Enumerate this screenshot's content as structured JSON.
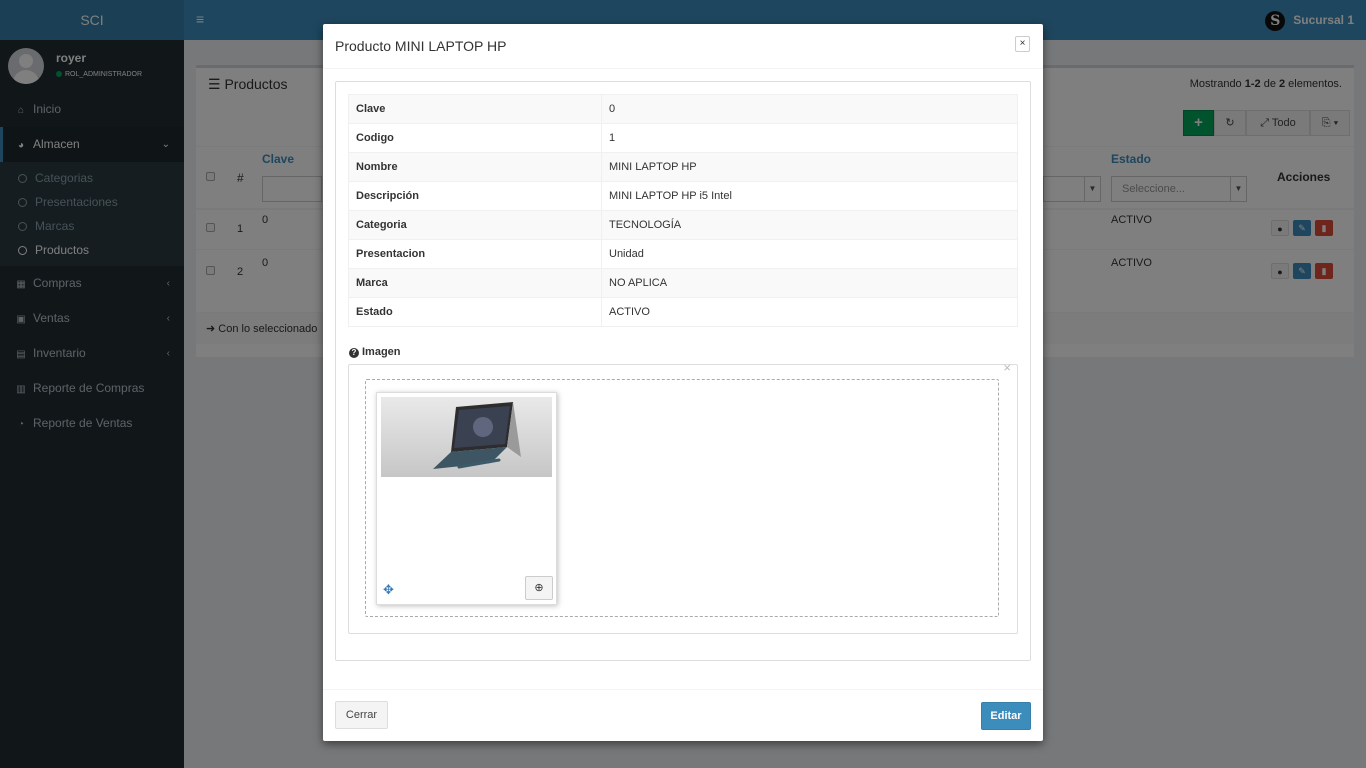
{
  "app": {
    "logo": "SCI",
    "branch": "Sucursal 1",
    "branch_logo_letter": "S"
  },
  "user": {
    "name": "royer",
    "role": "ROL_ADMINISTRADOR"
  },
  "sidebar": {
    "items": [
      {
        "label": "Inicio",
        "icon": "home-icon"
      },
      {
        "label": "Almacen",
        "icon": "dashboard-icon"
      },
      {
        "label": "Compras",
        "icon": "grid-icon"
      },
      {
        "label": "Ventas",
        "icon": "money-icon"
      },
      {
        "label": "Inventario",
        "icon": "file-icon"
      },
      {
        "label": "Reporte de Compras",
        "icon": "bar-chart-icon"
      },
      {
        "label": "Reporte de Ventas",
        "icon": "pie-chart-icon"
      }
    ],
    "submenu": [
      "Categorias",
      "Presentaciones",
      "Marcas",
      "Productos"
    ]
  },
  "list": {
    "title": "Productos",
    "count_prefix": "Mostrando ",
    "count_range": "1-2",
    "count_mid": " de ",
    "count_total": "2",
    "count_suffix": " elementos.",
    "todo_label": "Todo",
    "headers": {
      "num": "#",
      "clave": "Clave",
      "estado": "Estado",
      "acciones": "Acciones"
    },
    "estado_placeholder": "Seleccione...",
    "rows": [
      {
        "num": "1",
        "clave": "0",
        "estado": "ACTIVO"
      },
      {
        "num": "2",
        "clave": "0",
        "estado": "ACTIVO"
      }
    ],
    "footer": "Con lo seleccionado"
  },
  "modal": {
    "title": "Producto MINI LAPTOP HP",
    "close": "×",
    "fields": [
      {
        "key": "Clave",
        "value": "0"
      },
      {
        "key": "Codigo",
        "value": "1"
      },
      {
        "key": "Nombre",
        "value": "MINI LAPTOP HP"
      },
      {
        "key": "Descripción",
        "value": "MINI LAPTOP HP i5 Intel"
      },
      {
        "key": "Categoria",
        "value": "TECNOLOGÍA"
      },
      {
        "key": "Presentacion",
        "value": "Unidad"
      },
      {
        "key": "Marca",
        "value": "NO APLICA"
      },
      {
        "key": "Estado",
        "value": "ACTIVO"
      }
    ],
    "image_label": "Imagen",
    "file_remove": "×",
    "cerrar": "Cerrar",
    "editar": "Editar"
  },
  "colors": {
    "header": "#3c8dbc",
    "sidebar": "#222d32",
    "primary": "#3c8dbc",
    "success": "#00a65a",
    "danger": "#dd4b39"
  }
}
